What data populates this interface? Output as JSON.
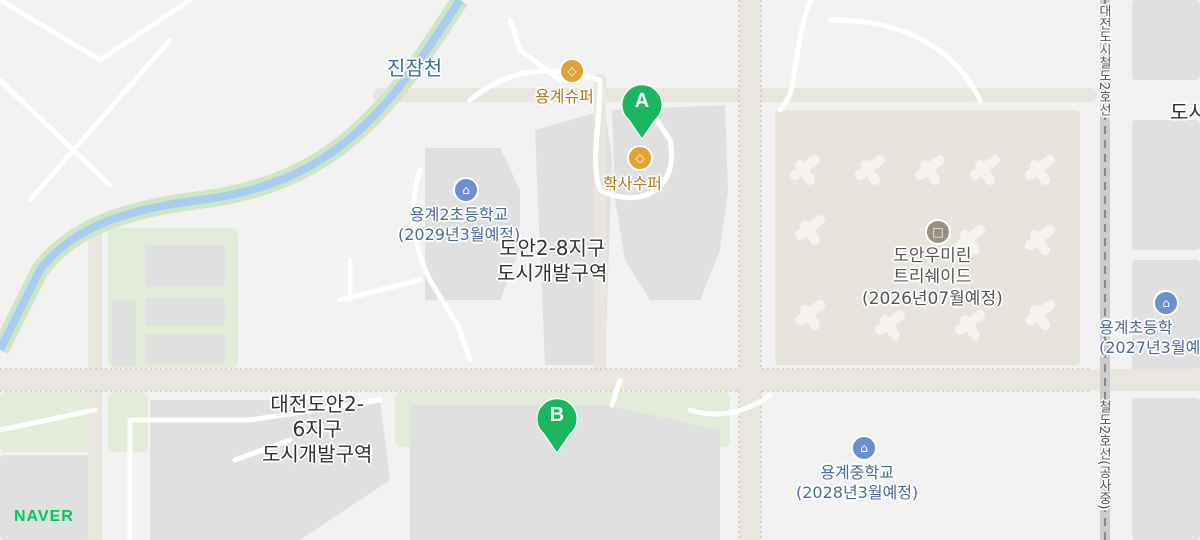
{
  "labels": {
    "stream": "진잠천",
    "shop_1": "용계슈퍼",
    "shop_2": "학사수퍼",
    "school_1": [
      "용계2초등학교",
      "(2029년3월예정)"
    ],
    "district_1": [
      "도안2-8지구",
      "도시개발구역"
    ],
    "apartment": [
      "도안우미린",
      "트리쉐이드",
      "(2026년07월예정)"
    ],
    "school_2": [
      "용계초등학",
      "(2027년3월예"
    ],
    "district_2": [
      "대전도안2-",
      "6지구",
      "도시개발구역"
    ],
    "school_3": [
      "용계중학교",
      "(2028년3월예정)"
    ],
    "rail": "대전도시철도2호선",
    "rail_bottom": "철도2호선(공사중)",
    "edge_top_right": "도시"
  },
  "markers": [
    {
      "letter": "A",
      "color": "#1bb760"
    },
    {
      "letter": "B",
      "color": "#1bb760"
    }
  ],
  "brand": {
    "logo": "NAVER",
    "color": "#03c75a"
  }
}
